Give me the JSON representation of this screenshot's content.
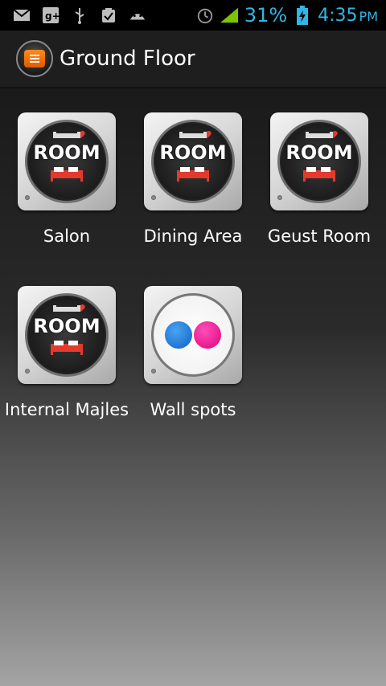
{
  "status_bar": {
    "icons": [
      "gmail-icon",
      "google-plus-icon",
      "usb-icon",
      "clipboard-check-icon",
      "android-icon",
      "alarm-icon",
      "signal-icon",
      "battery-charging-icon"
    ],
    "battery_percent": "31%",
    "time": "4:35",
    "ampm": "PM",
    "accent_color": "#33b5e5"
  },
  "action_bar": {
    "title": "Ground Floor",
    "logo_icon": "menu-logo-icon"
  },
  "tiles": [
    {
      "label": "Salon",
      "icon": "room-icon",
      "icon_text": "ROOM"
    },
    {
      "label": "Dining Area",
      "icon": "room-icon",
      "icon_text": "ROOM"
    },
    {
      "label": "Geust Room",
      "icon": "room-icon",
      "icon_text": "ROOM"
    },
    {
      "label": "Internal Majles",
      "icon": "room-icon",
      "icon_text": "ROOM"
    },
    {
      "label": "Wall spots",
      "icon": "flickr-icon"
    }
  ]
}
